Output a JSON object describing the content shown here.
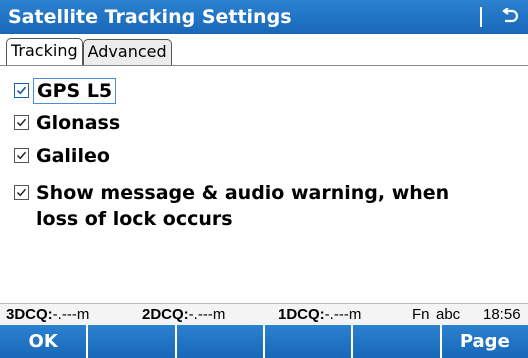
{
  "window": {
    "title": "Satellite Tracking Settings",
    "back_icon": "return-arrow-icon"
  },
  "tabs": [
    {
      "label": "Tracking",
      "active": true
    },
    {
      "label": "Advanced",
      "active": false
    }
  ],
  "options": [
    {
      "label": "GPS L5",
      "checked": true
    },
    {
      "label": "Glonass",
      "checked": true
    },
    {
      "label": "Galileo",
      "checked": true
    },
    {
      "label_line1": "Show message & audio warning, when",
      "label_line2": "loss of lock occurs",
      "checked": true
    }
  ],
  "status": {
    "dcq3_label": "3DCQ:",
    "dcq3_value": "-.---m",
    "dcq2_label": "2DCQ:",
    "dcq2_value": "-.---m",
    "dcq1_label": "1DCQ:",
    "dcq1_value": "-.---m",
    "fn": "Fn",
    "input_mode": "abc",
    "time": "18:56"
  },
  "softkeys": [
    "OK",
    "",
    "",
    "",
    "",
    "Page"
  ],
  "colors": {
    "accent": "#1e6fc0",
    "focus_border": "#4a8ed6"
  }
}
